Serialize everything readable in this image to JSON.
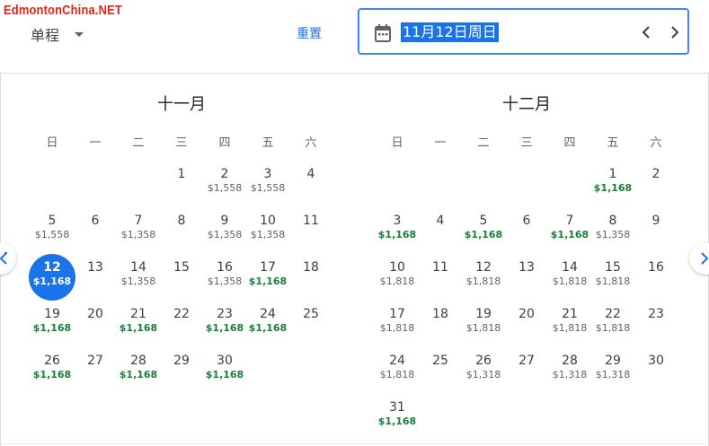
{
  "watermark": "EdmontonChina.NET",
  "header": {
    "trip_type": "单程",
    "reset_label": "重置",
    "date_value": "11月12日周日"
  },
  "colors": {
    "accent": "#1a73e8",
    "low_price": "#188038",
    "watermark": "#e0231c"
  },
  "months": [
    {
      "title": "十一月",
      "weekdays": [
        "日",
        "一",
        "二",
        "三",
        "四",
        "五",
        "六"
      ],
      "lead_blanks": 3,
      "days": [
        {
          "d": "1",
          "p": ""
        },
        {
          "d": "2",
          "p": "$1,558"
        },
        {
          "d": "3",
          "p": "$1,558"
        },
        {
          "d": "4",
          "p": ""
        },
        {
          "d": "5",
          "p": "$1,558"
        },
        {
          "d": "6",
          "p": ""
        },
        {
          "d": "7",
          "p": "$1,358"
        },
        {
          "d": "8",
          "p": ""
        },
        {
          "d": "9",
          "p": "$1,358"
        },
        {
          "d": "10",
          "p": "$1,358"
        },
        {
          "d": "11",
          "p": ""
        },
        {
          "d": "12",
          "p": "$1,168",
          "low": true,
          "selected": true
        },
        {
          "d": "13",
          "p": ""
        },
        {
          "d": "14",
          "p": "$1,358"
        },
        {
          "d": "15",
          "p": ""
        },
        {
          "d": "16",
          "p": "$1,358"
        },
        {
          "d": "17",
          "p": "$1,168",
          "low": true
        },
        {
          "d": "18",
          "p": ""
        },
        {
          "d": "19",
          "p": "$1,168",
          "low": true
        },
        {
          "d": "20",
          "p": ""
        },
        {
          "d": "21",
          "p": "$1,168",
          "low": true
        },
        {
          "d": "22",
          "p": ""
        },
        {
          "d": "23",
          "p": "$1,168",
          "low": true
        },
        {
          "d": "24",
          "p": "$1,168",
          "low": true
        },
        {
          "d": "25",
          "p": ""
        },
        {
          "d": "26",
          "p": "$1,168",
          "low": true
        },
        {
          "d": "27",
          "p": ""
        },
        {
          "d": "28",
          "p": "$1,168",
          "low": true
        },
        {
          "d": "29",
          "p": ""
        },
        {
          "d": "30",
          "p": "$1,168",
          "low": true
        }
      ]
    },
    {
      "title": "十二月",
      "weekdays": [
        "日",
        "一",
        "二",
        "三",
        "四",
        "五",
        "六"
      ],
      "lead_blanks": 5,
      "days": [
        {
          "d": "1",
          "p": "$1,168",
          "low": true
        },
        {
          "d": "2",
          "p": ""
        },
        {
          "d": "3",
          "p": "$1,168",
          "low": true
        },
        {
          "d": "4",
          "p": ""
        },
        {
          "d": "5",
          "p": "$1,168",
          "low": true
        },
        {
          "d": "6",
          "p": ""
        },
        {
          "d": "7",
          "p": "$1,168",
          "low": true
        },
        {
          "d": "8",
          "p": "$1,358"
        },
        {
          "d": "9",
          "p": ""
        },
        {
          "d": "10",
          "p": "$1,818"
        },
        {
          "d": "11",
          "p": ""
        },
        {
          "d": "12",
          "p": "$1,818"
        },
        {
          "d": "13",
          "p": ""
        },
        {
          "d": "14",
          "p": "$1,818"
        },
        {
          "d": "15",
          "p": "$1,818"
        },
        {
          "d": "16",
          "p": ""
        },
        {
          "d": "17",
          "p": "$1,818"
        },
        {
          "d": "18",
          "p": ""
        },
        {
          "d": "19",
          "p": "$1,818"
        },
        {
          "d": "20",
          "p": ""
        },
        {
          "d": "21",
          "p": "$1,818"
        },
        {
          "d": "22",
          "p": "$1,818"
        },
        {
          "d": "23",
          "p": ""
        },
        {
          "d": "24",
          "p": "$1,818"
        },
        {
          "d": "25",
          "p": ""
        },
        {
          "d": "26",
          "p": "$1,318"
        },
        {
          "d": "27",
          "p": ""
        },
        {
          "d": "28",
          "p": "$1,318"
        },
        {
          "d": "29",
          "p": "$1,318"
        },
        {
          "d": "30",
          "p": ""
        },
        {
          "d": "31",
          "p": "$1,168",
          "low": true
        }
      ]
    }
  ]
}
